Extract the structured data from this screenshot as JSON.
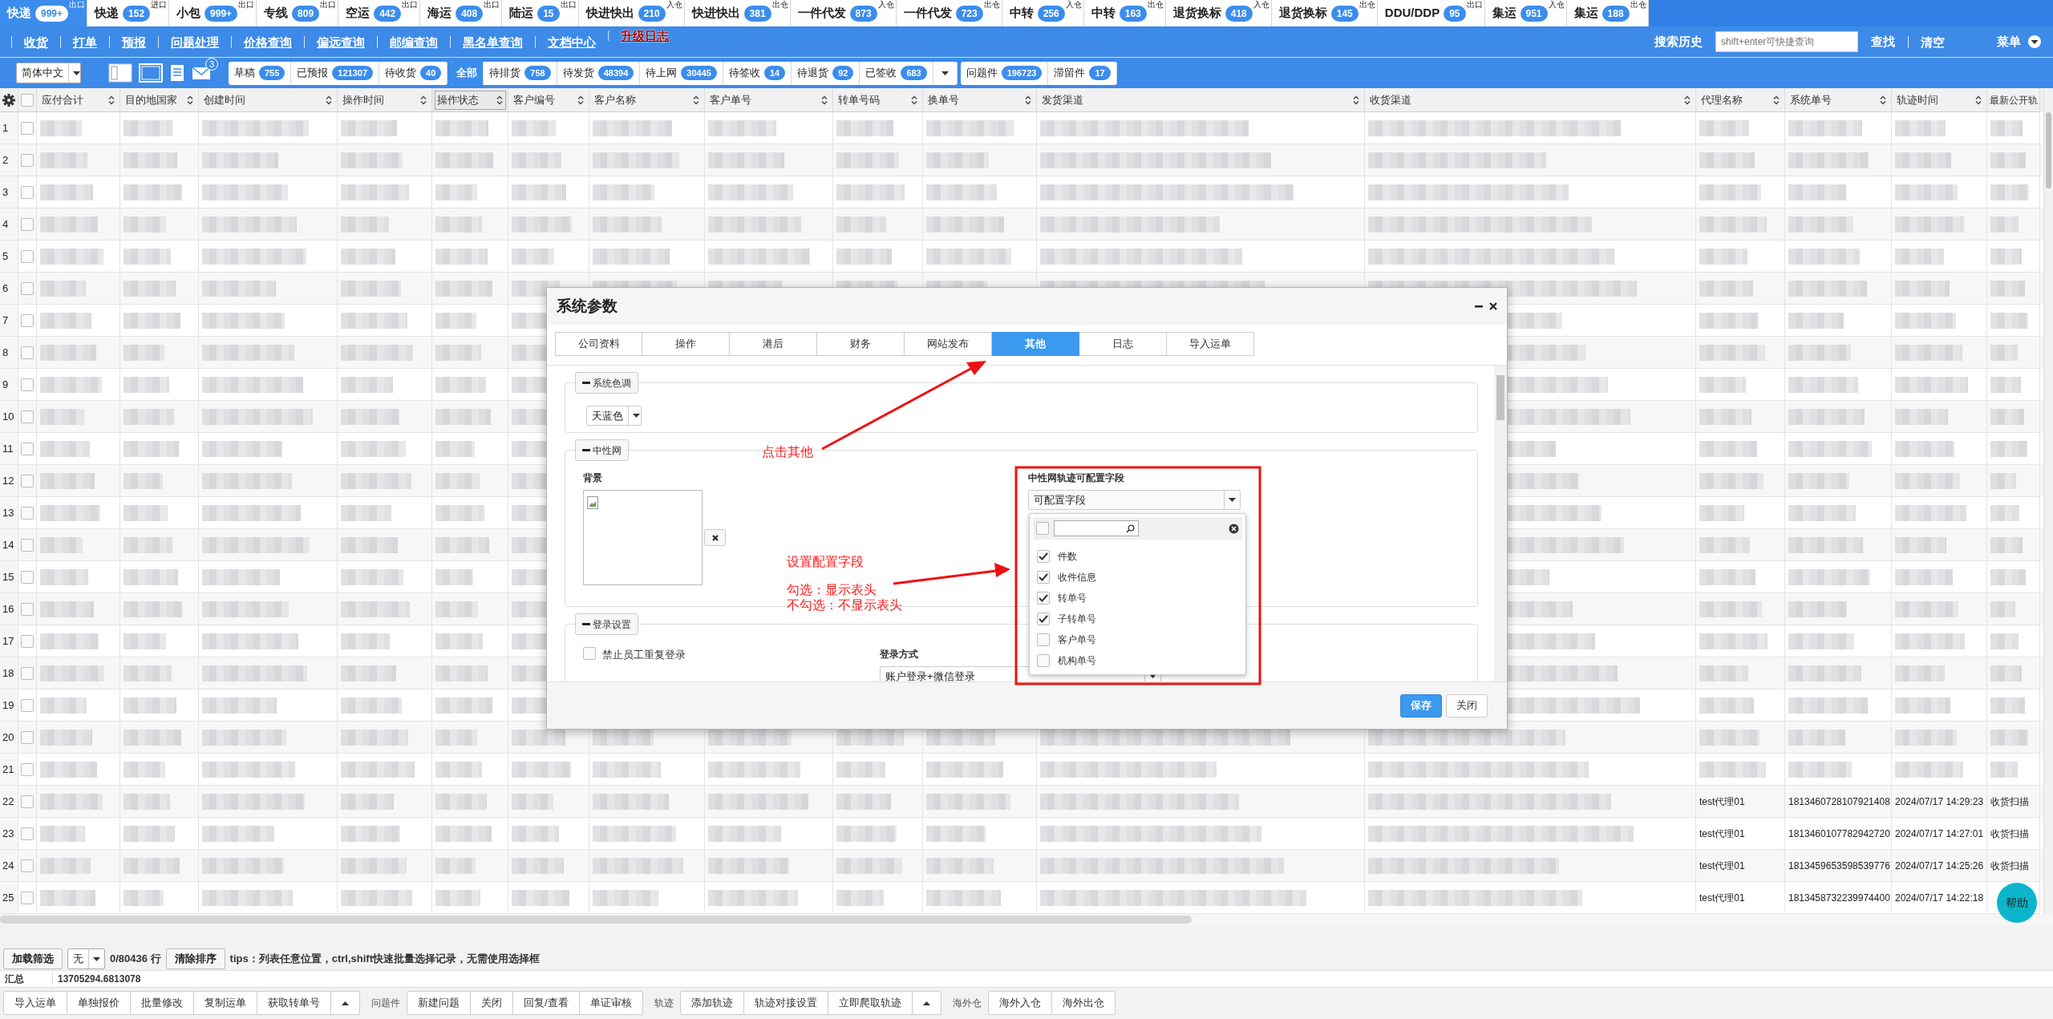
{
  "top_tabs": [
    {
      "label": "快递",
      "count": "999+",
      "tag": "出口",
      "selected": true
    },
    {
      "label": "快递",
      "count": "152",
      "tag": "进口",
      "selected": false
    },
    {
      "label": "小包",
      "count": "999+",
      "tag": "出口",
      "selected": false
    },
    {
      "label": "专线",
      "count": "809",
      "tag": "出口",
      "selected": false
    },
    {
      "label": "空运",
      "count": "442",
      "tag": "出口",
      "selected": false
    },
    {
      "label": "海运",
      "count": "408",
      "tag": "出口",
      "selected": false
    },
    {
      "label": "陆运",
      "count": "15",
      "tag": "出口",
      "selected": false
    },
    {
      "label": "快进快出",
      "count": "210",
      "tag": "入仓",
      "selected": false
    },
    {
      "label": "快进快出",
      "count": "381",
      "tag": "出仓",
      "selected": false
    },
    {
      "label": "一件代发",
      "count": "873",
      "tag": "入仓",
      "selected": false
    },
    {
      "label": "一件代发",
      "count": "723",
      "tag": "出仓",
      "selected": false
    },
    {
      "label": "中转",
      "count": "256",
      "tag": "入仓",
      "selected": false
    },
    {
      "label": "中转",
      "count": "163",
      "tag": "出仓",
      "selected": false
    },
    {
      "label": "退货换标",
      "count": "418",
      "tag": "入仓",
      "selected": false
    },
    {
      "label": "退货换标",
      "count": "145",
      "tag": "出仓",
      "selected": false
    },
    {
      "label": "DDU/DDP",
      "count": "95",
      "tag": "出口",
      "selected": false
    },
    {
      "label": "集运",
      "count": "951",
      "tag": "入仓",
      "selected": false
    },
    {
      "label": "集运",
      "count": "188",
      "tag": "出仓",
      "selected": false
    }
  ],
  "menu_bar": {
    "items": [
      {
        "label": "收货",
        "alert": false
      },
      {
        "label": "打单",
        "alert": false
      },
      {
        "label": "预报",
        "alert": false
      },
      {
        "label": "问题处理",
        "alert": false
      },
      {
        "label": "价格查询",
        "alert": false
      },
      {
        "label": "偏远查询",
        "alert": false
      },
      {
        "label": "邮编查询",
        "alert": false
      },
      {
        "label": "黑名单查询",
        "alert": false
      },
      {
        "label": "文档中心",
        "alert": false
      },
      {
        "label": "升级日志",
        "alert": true
      }
    ],
    "history_label": "搜索历史",
    "search": {
      "placeholder": "shift+enter可快捷查询"
    },
    "find": "查找",
    "clear": "清空",
    "menu": "菜单"
  },
  "filter_bar": {
    "language": "简体中文",
    "mail_count": "3",
    "groups": [
      {
        "has_menu": false,
        "items": [
          {
            "label": "草稿",
            "count": "755",
            "selected": false
          },
          {
            "label": "已预报",
            "count": "121307",
            "selected": false
          },
          {
            "label": "待收货",
            "count": "40",
            "selected": false
          }
        ]
      },
      {
        "has_menu": true,
        "items": [
          {
            "label": "全部",
            "selected": true
          },
          {
            "label": "待排货",
            "count": "758",
            "selected": false
          },
          {
            "label": "待发货",
            "count": "48394",
            "selected": false
          },
          {
            "label": "待上网",
            "count": "30445",
            "selected": false
          },
          {
            "label": "待签收",
            "count": "14",
            "selected": false
          },
          {
            "label": "待退货",
            "count": "92",
            "selected": false
          },
          {
            "label": "已签收",
            "count": "683",
            "selected": false
          }
        ]
      },
      {
        "has_menu": false,
        "items": [
          {
            "label": "问题件",
            "count": "196723",
            "selected": false
          },
          {
            "label": "滞留件",
            "count": "17",
            "selected": false
          }
        ]
      }
    ]
  },
  "table": {
    "all_checked": false,
    "columns": [
      {
        "label": "应付合计",
        "highlighted": false
      },
      {
        "label": "目的地国家",
        "highlighted": false
      },
      {
        "label": "创建时间",
        "highlighted": false
      },
      {
        "label": "操作时间",
        "highlighted": false
      },
      {
        "label": "操作状态",
        "highlighted": true
      },
      {
        "label": "客户编号",
        "highlighted": false
      },
      {
        "label": "客户名称",
        "highlighted": false
      },
      {
        "label": "客户单号",
        "highlighted": false
      },
      {
        "label": "转单号码",
        "highlighted": false
      },
      {
        "label": "换单号",
        "highlighted": false
      },
      {
        "label": "发货渠道",
        "highlighted": false
      },
      {
        "label": "收货渠道",
        "highlighted": false
      },
      {
        "label": "代理名称",
        "highlighted": false
      },
      {
        "label": "系统单号",
        "highlighted": false
      },
      {
        "label": "轨迹时间",
        "highlighted": false
      },
      {
        "label": "最新公开轨",
        "highlighted": false
      }
    ],
    "rows": [
      {
        "number": "1",
        "checked": false
      },
      {
        "number": "2",
        "checked": false
      },
      {
        "number": "3",
        "checked": false
      },
      {
        "number": "4",
        "checked": false
      },
      {
        "number": "5",
        "checked": false
      },
      {
        "number": "6",
        "checked": false
      },
      {
        "number": "7",
        "checked": false
      },
      {
        "number": "8",
        "checked": false
      },
      {
        "number": "9",
        "checked": false
      },
      {
        "number": "10",
        "checked": false
      },
      {
        "number": "11",
        "checked": false
      },
      {
        "number": "12",
        "checked": false
      },
      {
        "number": "13",
        "checked": false
      },
      {
        "number": "14",
        "checked": false
      },
      {
        "number": "15",
        "checked": false
      },
      {
        "number": "16",
        "checked": false
      },
      {
        "number": "17",
        "checked": false
      },
      {
        "number": "18",
        "checked": false
      },
      {
        "number": "19",
        "checked": false
      },
      {
        "number": "20",
        "checked": false
      },
      {
        "number": "21",
        "checked": false
      },
      {
        "number": "22",
        "checked": false,
        "agent": "test代理01",
        "system_no": "1813460728107921408",
        "track_time": "2024/07/17 14:29:23",
        "latest_track": "收货扫描"
      },
      {
        "number": "23",
        "checked": false,
        "agent": "test代理01",
        "system_no": "1813460107782942720",
        "track_time": "2024/07/17 14:27:01",
        "latest_track": "收货扫描"
      },
      {
        "number": "24",
        "checked": false,
        "agent": "test代理01",
        "system_no": "1813459653598539776",
        "track_time": "2024/07/17 14:25:26",
        "latest_track": "收货扫描"
      },
      {
        "number": "25",
        "checked": false,
        "agent": "test代理01",
        "system_no": "1813458732239974400",
        "track_time": "2024/07/17 14:22:18"
      }
    ]
  },
  "dialog": {
    "title": "系统参数",
    "tabs": [
      {
        "label": "公司资料",
        "selected": false
      },
      {
        "label": "操作",
        "selected": false
      },
      {
        "label": "港后",
        "selected": false
      },
      {
        "label": "财务",
        "selected": false
      },
      {
        "label": "网站发布",
        "selected": false
      },
      {
        "label": "其他",
        "selected": true
      },
      {
        "label": "日志",
        "selected": false
      },
      {
        "label": "导入运单",
        "selected": false
      }
    ],
    "color_section": {
      "legend": "系统色调",
      "select": "天蓝色"
    },
    "neutral_section": {
      "legend": "中性网",
      "background_label": "背景",
      "fields_label": "中性网轨迹可配置字段",
      "fields_select": "可配置字段",
      "select_all": false,
      "options": [
        {
          "label": "件数",
          "checked": true
        },
        {
          "label": "收件信息",
          "checked": true
        },
        {
          "label": "转单号",
          "checked": true
        },
        {
          "label": "子转单号",
          "checked": true
        },
        {
          "label": "客户单号",
          "checked": false
        },
        {
          "label": "机构单号",
          "checked": false
        }
      ]
    },
    "login_section": {
      "legend": "登录设置",
      "deny_duplicate": {
        "label": "禁止员工重复登录",
        "checked": false
      },
      "method_label": "登录方式",
      "method_select": "账户登录+微信登录"
    },
    "buttons": [
      {
        "label": "保存",
        "kind": "primary"
      },
      {
        "label": "关闭",
        "kind": "default"
      }
    ]
  },
  "annotations": {
    "click_hint": "点击其他",
    "setup_hint": "设置配置字段",
    "checked_hint": "勾选：显示表头",
    "unchecked_hint": "不勾选：不显示表头"
  },
  "footer": {
    "load_filter": "加载筛选",
    "filter_select": "无",
    "row_count": "0/80436 行",
    "clear_sort": "清除排序",
    "tips": "tips：列表任意位置，ctrl,shift快速批量选择记录，无需使用选择框",
    "summary_label": "汇总",
    "summary_value": "13705294.6813078"
  },
  "toolbar": [
    {
      "has_menu": true,
      "buttons": [
        "导入运单",
        "单独报价",
        "批量修改",
        "复制运单",
        "获取转单号"
      ]
    },
    {
      "label": "问题件",
      "has_menu": false,
      "buttons": [
        "新建问题",
        "关闭",
        "回复/查看",
        "单证审核"
      ]
    },
    {
      "label": "轨迹",
      "has_menu": true,
      "buttons": [
        "添加轨迹",
        "轨迹对接设置",
        "立即爬取轨迹"
      ]
    },
    {
      "label": "海外仓",
      "has_menu": false,
      "buttons": [
        "海外入仓",
        "海外出仓"
      ]
    }
  ],
  "help_button": "帮助"
}
